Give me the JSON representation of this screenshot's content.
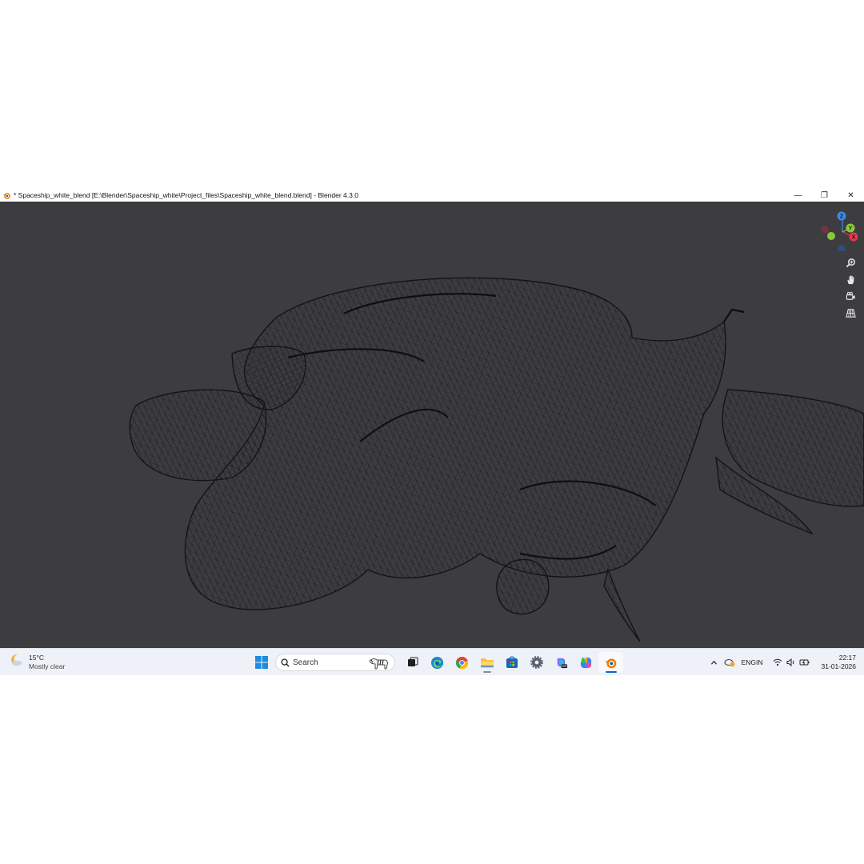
{
  "window": {
    "title": "* Spaceship_white_blend [E:\\Blender\\Spaceship_white\\Project_files\\Spaceship_white_blend.blend] - Blender 4.3.0",
    "controls": {
      "minimize": "—",
      "restore": "❐",
      "close": "✕"
    }
  },
  "viewport": {
    "background": "#3d3c3f",
    "wire_color": "#151416",
    "gizmo": {
      "axis_z": "Z",
      "axis_y": "Y",
      "axis_x": "X"
    },
    "nav_tools": [
      "zoom-icon",
      "pan-hand-icon",
      "camera-view-icon",
      "grid-perspective-icon"
    ]
  },
  "taskbar": {
    "weather": {
      "temperature": "15°C",
      "condition": "Mostly clear"
    },
    "search": {
      "placeholder": "Search"
    },
    "pinned": [
      "start-icon",
      "task-view-icon",
      "edge-icon",
      "chrome-icon",
      "file-explorer-icon",
      "store-icon",
      "settings-icon",
      "copilot-pre-icon",
      "copilot-icon",
      "blender-icon"
    ],
    "tray": {
      "language_top": "ENG",
      "language_bottom": "IN",
      "time": "22:17",
      "date": "31-01-2026"
    }
  },
  "colors": {
    "accent": "#0a64c8",
    "blender_orange": "#e87d0d",
    "axis_x": "#e8384f",
    "axis_y": "#8cc83c",
    "axis_z": "#3c8ae6"
  }
}
